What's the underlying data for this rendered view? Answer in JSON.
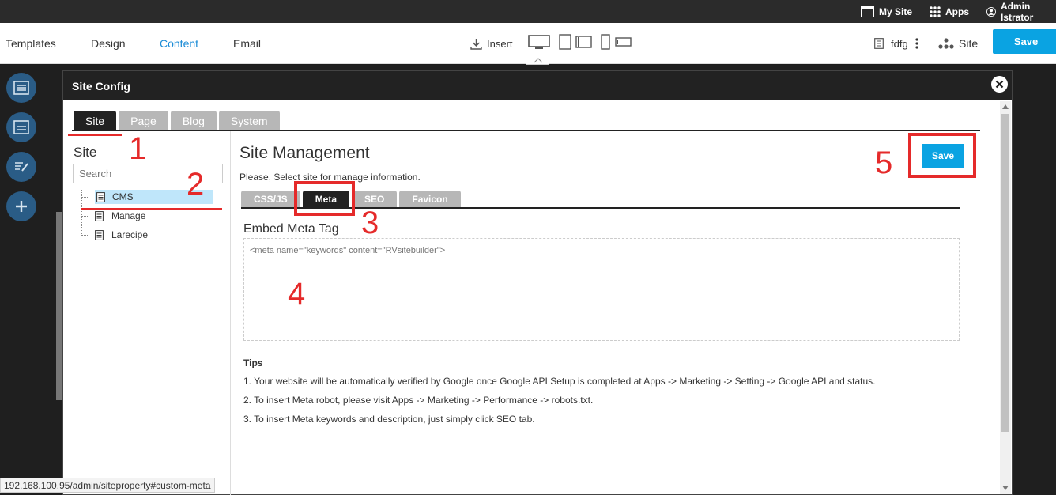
{
  "topbar": {
    "my_site": "My Site",
    "apps": "Apps",
    "user": "Admin Istrator"
  },
  "toolbar": {
    "nav": [
      "Templates",
      "Design",
      "Content",
      "Email"
    ],
    "active_nav": "Content",
    "insert": "Insert",
    "page_name": "fdfg",
    "site": "Site",
    "save": "Save"
  },
  "modal": {
    "title": "Site Config",
    "tabs": [
      "Site",
      "Page",
      "Blog",
      "System"
    ],
    "active_tab": "Site",
    "sidebar": {
      "title": "Site",
      "search_placeholder": "Search",
      "items": [
        "CMS",
        "Manage",
        "Larecipe"
      ],
      "selected": "CMS"
    },
    "content": {
      "title": "Site Management",
      "description": "Please, Select site for manage information.",
      "save": "Save",
      "subtabs": [
        "CSS/JS",
        "Meta",
        "SEO",
        "Favicon"
      ],
      "active_subtab": "Meta",
      "embed_label": "Embed Meta Tag",
      "meta_placeholder": "<meta name=\"keywords\" content=\"RVsitebuilder\">",
      "tips_title": "Tips",
      "tips": [
        "1. Your website will be automatically verified by Google once Google API Setup is completed at Apps -> Marketing -> Setting -> Google API and status.",
        "2. To insert Meta robot, please visit Apps -> Marketing -> Performance -> robots.txt.",
        "3. To insert Meta keywords and description, just simply click SEO tab."
      ]
    }
  },
  "annotations": [
    "1",
    "2",
    "3",
    "4",
    "5"
  ],
  "status_url": "192.168.100.95/admin/siteproperty#custom-meta",
  "colors": {
    "accent": "#0aa3e2",
    "annotation": "#e52a2a",
    "dark": "#222222"
  }
}
